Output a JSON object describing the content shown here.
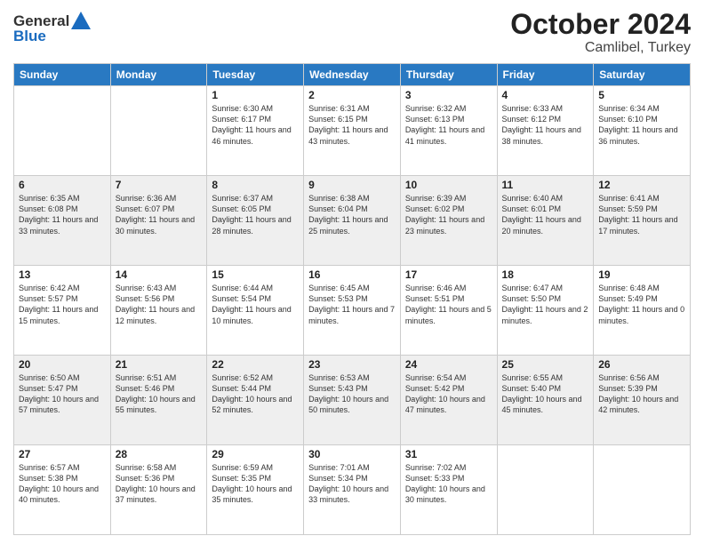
{
  "logo": {
    "line1": "General",
    "line2": "Blue"
  },
  "title": "October 2024",
  "subtitle": "Camlibel, Turkey",
  "days_of_week": [
    "Sunday",
    "Monday",
    "Tuesday",
    "Wednesday",
    "Thursday",
    "Friday",
    "Saturday"
  ],
  "weeks": [
    [
      {
        "day": "",
        "content": ""
      },
      {
        "day": "",
        "content": ""
      },
      {
        "day": "1",
        "content": "Sunrise: 6:30 AM\nSunset: 6:17 PM\nDaylight: 11 hours and 46 minutes."
      },
      {
        "day": "2",
        "content": "Sunrise: 6:31 AM\nSunset: 6:15 PM\nDaylight: 11 hours and 43 minutes."
      },
      {
        "day": "3",
        "content": "Sunrise: 6:32 AM\nSunset: 6:13 PM\nDaylight: 11 hours and 41 minutes."
      },
      {
        "day": "4",
        "content": "Sunrise: 6:33 AM\nSunset: 6:12 PM\nDaylight: 11 hours and 38 minutes."
      },
      {
        "day": "5",
        "content": "Sunrise: 6:34 AM\nSunset: 6:10 PM\nDaylight: 11 hours and 36 minutes."
      }
    ],
    [
      {
        "day": "6",
        "content": "Sunrise: 6:35 AM\nSunset: 6:08 PM\nDaylight: 11 hours and 33 minutes."
      },
      {
        "day": "7",
        "content": "Sunrise: 6:36 AM\nSunset: 6:07 PM\nDaylight: 11 hours and 30 minutes."
      },
      {
        "day": "8",
        "content": "Sunrise: 6:37 AM\nSunset: 6:05 PM\nDaylight: 11 hours and 28 minutes."
      },
      {
        "day": "9",
        "content": "Sunrise: 6:38 AM\nSunset: 6:04 PM\nDaylight: 11 hours and 25 minutes."
      },
      {
        "day": "10",
        "content": "Sunrise: 6:39 AM\nSunset: 6:02 PM\nDaylight: 11 hours and 23 minutes."
      },
      {
        "day": "11",
        "content": "Sunrise: 6:40 AM\nSunset: 6:01 PM\nDaylight: 11 hours and 20 minutes."
      },
      {
        "day": "12",
        "content": "Sunrise: 6:41 AM\nSunset: 5:59 PM\nDaylight: 11 hours and 17 minutes."
      }
    ],
    [
      {
        "day": "13",
        "content": "Sunrise: 6:42 AM\nSunset: 5:57 PM\nDaylight: 11 hours and 15 minutes."
      },
      {
        "day": "14",
        "content": "Sunrise: 6:43 AM\nSunset: 5:56 PM\nDaylight: 11 hours and 12 minutes."
      },
      {
        "day": "15",
        "content": "Sunrise: 6:44 AM\nSunset: 5:54 PM\nDaylight: 11 hours and 10 minutes."
      },
      {
        "day": "16",
        "content": "Sunrise: 6:45 AM\nSunset: 5:53 PM\nDaylight: 11 hours and 7 minutes."
      },
      {
        "day": "17",
        "content": "Sunrise: 6:46 AM\nSunset: 5:51 PM\nDaylight: 11 hours and 5 minutes."
      },
      {
        "day": "18",
        "content": "Sunrise: 6:47 AM\nSunset: 5:50 PM\nDaylight: 11 hours and 2 minutes."
      },
      {
        "day": "19",
        "content": "Sunrise: 6:48 AM\nSunset: 5:49 PM\nDaylight: 11 hours and 0 minutes."
      }
    ],
    [
      {
        "day": "20",
        "content": "Sunrise: 6:50 AM\nSunset: 5:47 PM\nDaylight: 10 hours and 57 minutes."
      },
      {
        "day": "21",
        "content": "Sunrise: 6:51 AM\nSunset: 5:46 PM\nDaylight: 10 hours and 55 minutes."
      },
      {
        "day": "22",
        "content": "Sunrise: 6:52 AM\nSunset: 5:44 PM\nDaylight: 10 hours and 52 minutes."
      },
      {
        "day": "23",
        "content": "Sunrise: 6:53 AM\nSunset: 5:43 PM\nDaylight: 10 hours and 50 minutes."
      },
      {
        "day": "24",
        "content": "Sunrise: 6:54 AM\nSunset: 5:42 PM\nDaylight: 10 hours and 47 minutes."
      },
      {
        "day": "25",
        "content": "Sunrise: 6:55 AM\nSunset: 5:40 PM\nDaylight: 10 hours and 45 minutes."
      },
      {
        "day": "26",
        "content": "Sunrise: 6:56 AM\nSunset: 5:39 PM\nDaylight: 10 hours and 42 minutes."
      }
    ],
    [
      {
        "day": "27",
        "content": "Sunrise: 6:57 AM\nSunset: 5:38 PM\nDaylight: 10 hours and 40 minutes."
      },
      {
        "day": "28",
        "content": "Sunrise: 6:58 AM\nSunset: 5:36 PM\nDaylight: 10 hours and 37 minutes."
      },
      {
        "day": "29",
        "content": "Sunrise: 6:59 AM\nSunset: 5:35 PM\nDaylight: 10 hours and 35 minutes."
      },
      {
        "day": "30",
        "content": "Sunrise: 7:01 AM\nSunset: 5:34 PM\nDaylight: 10 hours and 33 minutes."
      },
      {
        "day": "31",
        "content": "Sunrise: 7:02 AM\nSunset: 5:33 PM\nDaylight: 10 hours and 30 minutes."
      },
      {
        "day": "",
        "content": ""
      },
      {
        "day": "",
        "content": ""
      }
    ]
  ]
}
